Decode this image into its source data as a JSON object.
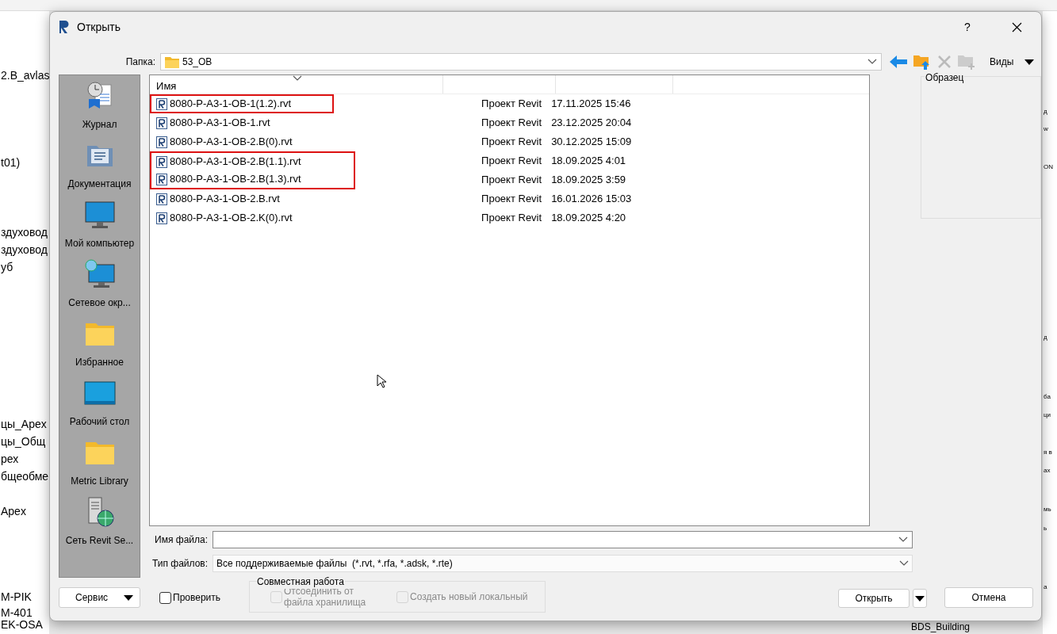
{
  "background": {
    "left_fragments": [
      "2.B_avlas",
      "t01)",
      "здуховод",
      "здуховод",
      "уб",
      "цы_Apex",
      "цы_Общ",
      "рех",
      "бщеобме",
      "Apex",
      "M-PIK",
      "M-401",
      "EK-OSA"
    ],
    "right_fragments": [
      "д",
      "w",
      "ON",
      "д",
      "ба",
      "ци",
      "я в",
      "ах",
      "мь",
      "ь",
      "а"
    ],
    "bottom_fragment": "BDS_Building"
  },
  "dialog": {
    "title": "Открыть",
    "help": "?",
    "folder": {
      "label": "Папка:",
      "value": "53_OB"
    },
    "toolbar": {
      "views": "Виды"
    },
    "places": [
      {
        "kind": "history",
        "label": "Журнал"
      },
      {
        "kind": "documents",
        "label": "Документация"
      },
      {
        "kind": "computer",
        "label": "Мой компьютер"
      },
      {
        "kind": "network",
        "label": "Сетевое окр..."
      },
      {
        "kind": "folder",
        "label": "Избранное"
      },
      {
        "kind": "desktop",
        "label": "Рабочий стол"
      },
      {
        "kind": "folder",
        "label": "Metric Library"
      },
      {
        "kind": "server",
        "label": "Сеть Revit Se..."
      }
    ],
    "columns": [
      "Имя"
    ],
    "files": [
      {
        "name": "8080-P-A3-1-OB-1(1.2).rvt",
        "type": "Проект Revit",
        "date": "17.11.2025 15:46",
        "highlighted": true
      },
      {
        "name": "8080-P-A3-1-OB-1.rvt",
        "type": "Проект Revit",
        "date": "23.12.2025 20:04",
        "highlighted": false
      },
      {
        "name": "8080-P-A3-1-OB-2.B(0).rvt",
        "type": "Проект Revit",
        "date": "30.12.2025 15:09",
        "highlighted": false
      },
      {
        "name": "8080-P-A3-1-OB-2.B(1.1).rvt",
        "type": "Проект Revit",
        "date": "18.09.2025 4:01",
        "highlighted": true
      },
      {
        "name": "8080-P-A3-1-OB-2.B(1.3).rvt",
        "type": "Проект Revit",
        "date": "18.09.2025 3:59",
        "highlighted": true
      },
      {
        "name": "8080-P-A3-1-OB-2.B.rvt",
        "type": "Проект Revit",
        "date": "16.01.2026 15:03",
        "highlighted": false
      },
      {
        "name": "8080-P-A3-1-OB-2.K(0).rvt",
        "type": "Проект Revit",
        "date": "18.09.2025 4:20",
        "highlighted": false
      }
    ],
    "preview": {
      "label": "Образец"
    },
    "filename": {
      "label": "Имя файла:"
    },
    "filetype": {
      "label": "Тип файлов:",
      "value": "Все поддерживаемые файлы  (*.rvt, *.rfa, *.adsk, *.rte)"
    },
    "service": "Сервис",
    "verify": {
      "label": "Проверить",
      "checked": false
    },
    "worksharing": {
      "label": "Совместная работа",
      "options": [
        {
          "label": "Отсоединить от файла хранилища",
          "checked": false,
          "disabled": true
        },
        {
          "label": "Создать новый локальный",
          "checked": false,
          "disabled": true
        }
      ]
    },
    "open": "Открыть",
    "cancel": "Отмена"
  }
}
